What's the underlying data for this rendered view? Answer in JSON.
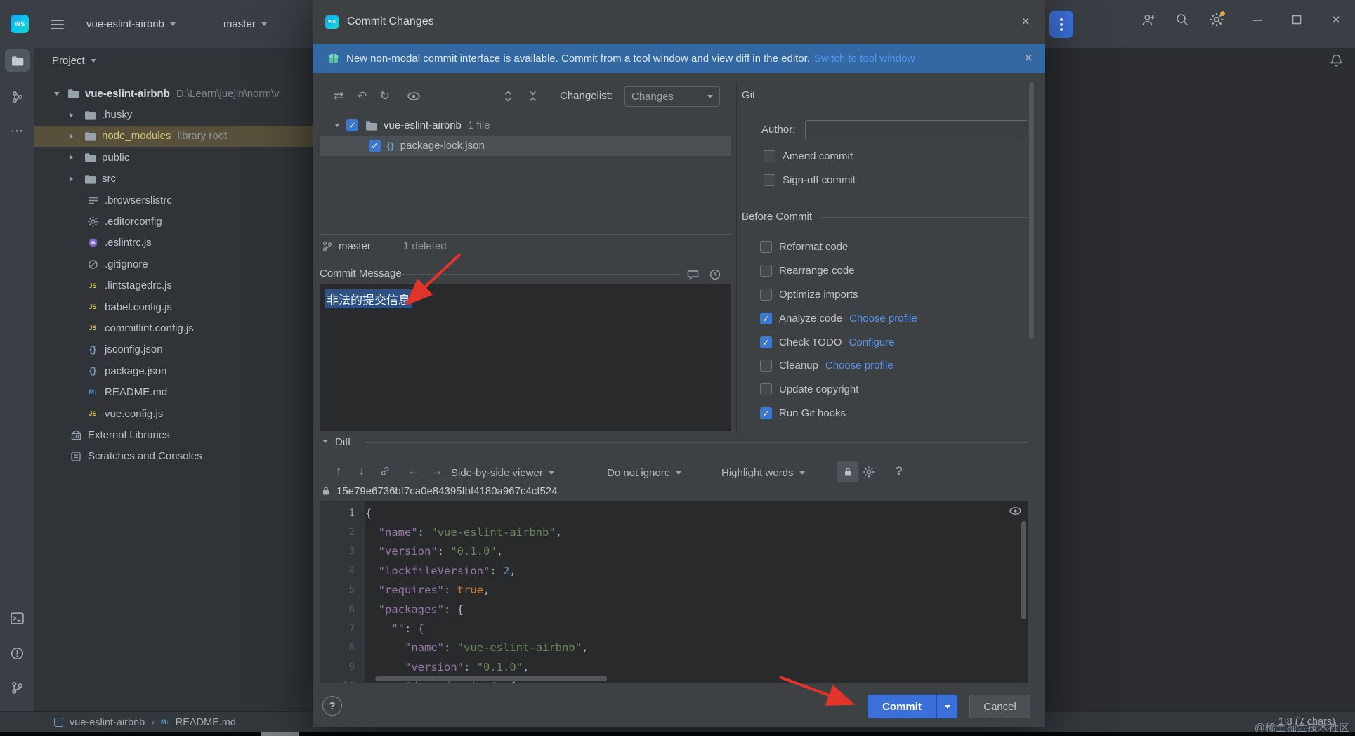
{
  "palette": {
    "accent_blue": "#3b70d9",
    "link_blue": "#5794f2",
    "banner_bg": "#3468a3",
    "checked_blue": "#3d78d0",
    "selection_bg": "#2d5185",
    "library_row_bg": "#57503a",
    "annotation_red": "#e2342b"
  },
  "titlebar": {
    "logo_text": "WS",
    "project_selector": "vue-eslint-airbnb",
    "branch_selector": "master"
  },
  "project_panel": {
    "header": "Project",
    "root": {
      "label": "vue-eslint-airbnb",
      "path": "D:\\Learn\\juejin\\norm\\v"
    },
    "items": [
      {
        "icon": "folder",
        "label": ".husky",
        "chevron": true
      },
      {
        "icon": "folder",
        "label": "node_modules",
        "chevron": true,
        "extra": "library root",
        "library": true
      },
      {
        "icon": "folder",
        "label": "public",
        "chevron": true
      },
      {
        "icon": "folder",
        "label": "src",
        "chevron": true
      },
      {
        "icon": "listfile",
        "label": ".browserslistrc"
      },
      {
        "icon": "gear",
        "label": ".editorconfig"
      },
      {
        "icon": "eslint",
        "label": ".eslintrc.js"
      },
      {
        "icon": "gitignore",
        "label": ".gitignore"
      },
      {
        "icon": "js",
        "label": ".lintstagedrc.js"
      },
      {
        "icon": "js",
        "label": "babel.config.js"
      },
      {
        "icon": "js",
        "label": "commitlint.config.js"
      },
      {
        "icon": "braces",
        "label": "jsconfig.json"
      },
      {
        "icon": "braces",
        "label": "package.json"
      },
      {
        "icon": "md",
        "label": "README.md"
      },
      {
        "icon": "js",
        "label": "vue.config.js"
      },
      {
        "icon": "library",
        "label": "External Libraries",
        "toplevel": true
      },
      {
        "icon": "scratch",
        "label": "Scratches and Consoles",
        "toplevel": true
      }
    ]
  },
  "dialog": {
    "title": "Commit Changes",
    "banner": {
      "text": "New non-modal commit interface is available. Commit from a tool window and view diff in the editor.",
      "link_label": "Switch to tool window"
    },
    "toolbar": {
      "changelist_label": "Changelist:",
      "changelist_value": "Changes"
    },
    "file_tree": {
      "group": "vue-eslint-airbnb",
      "group_meta": "1 file",
      "file": "package-lock.json"
    },
    "branch_row": {
      "branch": "master",
      "deleted": "1 deleted"
    },
    "message": {
      "label": "Commit Message",
      "text": "非法的提交信息"
    },
    "diff": {
      "header": "Diff",
      "viewer": "Side-by-side viewer",
      "ignore": "Do not ignore",
      "highlight": "Highlight words",
      "hash": "15e79e6736bf7ca0e84395fbf4180a967c4cf524",
      "lines": [
        {
          "n": "1",
          "tokens": [
            [
              "p",
              "{"
            ]
          ]
        },
        {
          "n": "2",
          "tokens": [
            [
              "p",
              "  "
            ],
            [
              "k",
              "\"name\""
            ],
            [
              "p",
              ": "
            ],
            [
              "s",
              "\"vue-eslint-airbnb\""
            ],
            [
              "p",
              ","
            ]
          ]
        },
        {
          "n": "3",
          "tokens": [
            [
              "p",
              "  "
            ],
            [
              "k",
              "\"version\""
            ],
            [
              "p",
              ": "
            ],
            [
              "s",
              "\"0.1.0\""
            ],
            [
              "p",
              ","
            ]
          ]
        },
        {
          "n": "4",
          "tokens": [
            [
              "p",
              "  "
            ],
            [
              "k",
              "\"lockfileVersion\""
            ],
            [
              "p",
              ": "
            ],
            [
              "d",
              "2"
            ],
            [
              "p",
              ","
            ]
          ]
        },
        {
          "n": "5",
          "tokens": [
            [
              "p",
              "  "
            ],
            [
              "k",
              "\"requires\""
            ],
            [
              "p",
              ": "
            ],
            [
              "b",
              "true"
            ],
            [
              "p",
              ","
            ]
          ]
        },
        {
          "n": "6",
          "tokens": [
            [
              "p",
              "  "
            ],
            [
              "k",
              "\"packages\""
            ],
            [
              "p",
              ": {"
            ]
          ]
        },
        {
          "n": "7",
          "tokens": [
            [
              "p",
              "    "
            ],
            [
              "k",
              "\"\""
            ],
            [
              "p",
              ": {"
            ]
          ]
        },
        {
          "n": "8",
          "tokens": [
            [
              "p",
              "      "
            ],
            [
              "k",
              "\"name\""
            ],
            [
              "p",
              ": "
            ],
            [
              "s",
              "\"vue-eslint-airbnb\""
            ],
            [
              "p",
              ","
            ]
          ]
        },
        {
          "n": "9",
          "tokens": [
            [
              "p",
              "      "
            ],
            [
              "k",
              "\"version\""
            ],
            [
              "p",
              ": "
            ],
            [
              "s",
              "\"0.1.0\""
            ],
            [
              "p",
              ","
            ]
          ]
        },
        {
          "n": "10",
          "tokens": [
            [
              "p",
              "      "
            ],
            [
              "k",
              "\"dependencies\""
            ],
            [
              "p",
              ": {"
            ]
          ]
        }
      ]
    },
    "git_panel": {
      "header": "Git",
      "author_label": "Author:",
      "amend_label": "Amend commit",
      "signoff_label": "Sign-off commit",
      "before_header": "Before Commit",
      "options": [
        {
          "label": "Reformat code",
          "checked": false
        },
        {
          "label": "Rearrange code",
          "checked": false
        },
        {
          "label": "Optimize imports",
          "checked": false
        },
        {
          "label": "Analyze code",
          "checked": true,
          "link": "Choose profile"
        },
        {
          "label": "Check TODO",
          "checked": true,
          "link": "Configure"
        },
        {
          "label": "Cleanup",
          "checked": false,
          "link": "Choose profile"
        },
        {
          "label": "Update copyright",
          "checked": false
        },
        {
          "label": "Run Git hooks",
          "checked": true
        }
      ]
    },
    "footer": {
      "help": "?",
      "commit": "Commit",
      "cancel": "Cancel"
    }
  },
  "status_bar": {
    "project": "vue-eslint-airbnb",
    "file": "README.md",
    "caret_info": "1:8 (7 chars)"
  },
  "watermark": "@稀土掘金技术社区"
}
